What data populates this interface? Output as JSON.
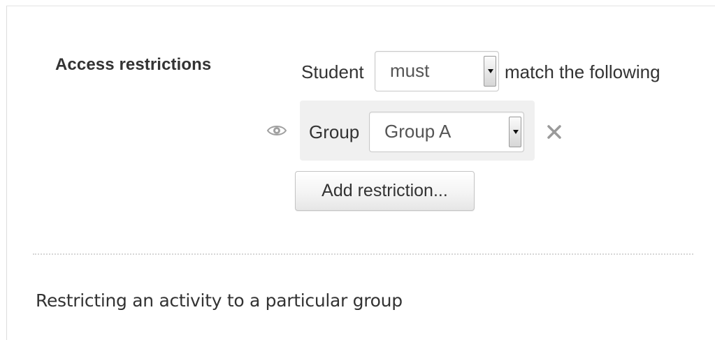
{
  "section": {
    "label": "Access restrictions"
  },
  "restriction_header": {
    "prefix": "Student",
    "mode_select": {
      "value": "must"
    },
    "suffix": "match the following"
  },
  "condition": {
    "type_label": "Group",
    "group_select": {
      "value": "Group A"
    },
    "visibility_icon": "eye-icon",
    "delete_icon": "close-icon"
  },
  "add_restriction_button": {
    "label": "Add restriction..."
  },
  "caption": "Restricting an activity to a particular group"
}
